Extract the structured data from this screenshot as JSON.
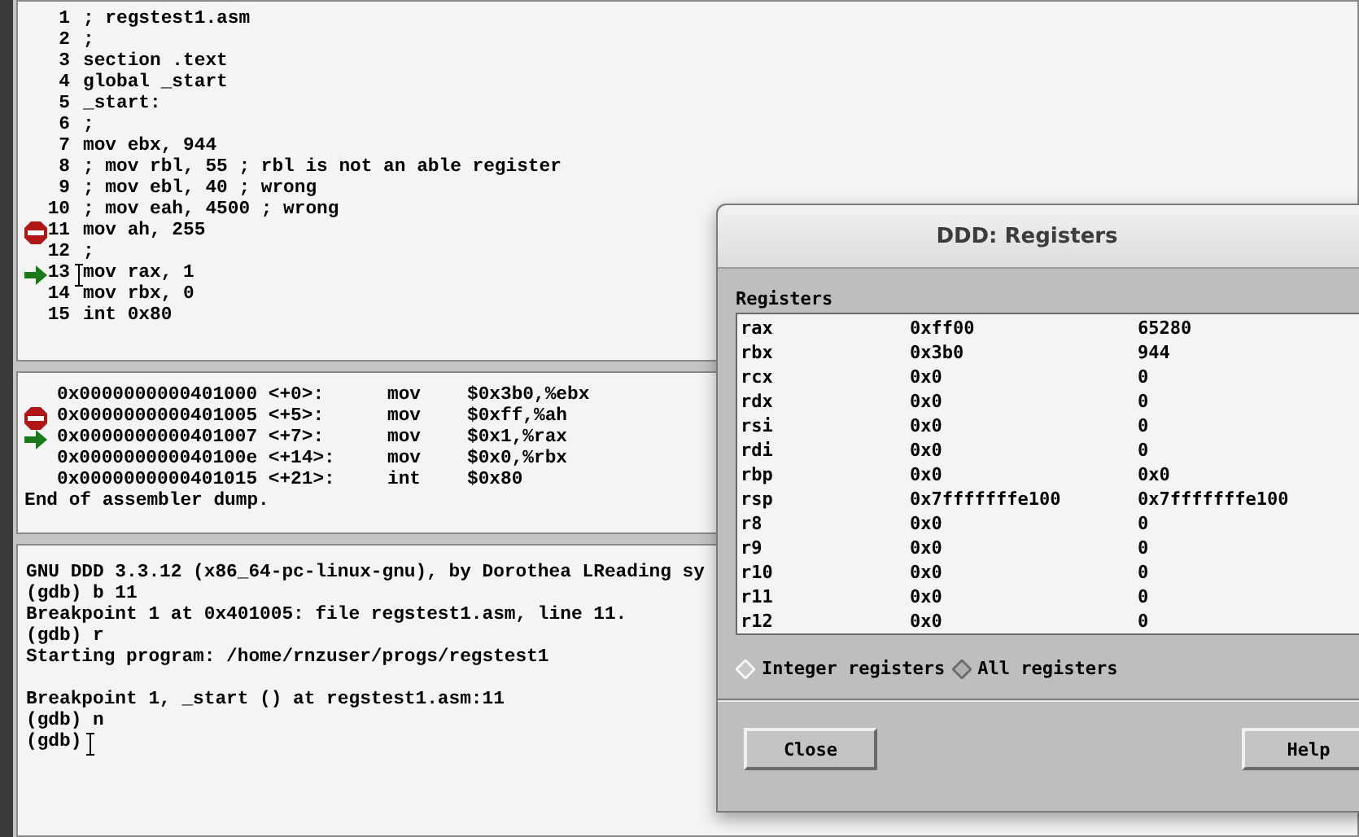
{
  "source": {
    "lines": [
      {
        "number": "1",
        "text": "; regstest1.asm",
        "breakpoint": false,
        "current": false
      },
      {
        "number": "2",
        "text": ";",
        "breakpoint": false,
        "current": false
      },
      {
        "number": "3",
        "text": "section .text",
        "breakpoint": false,
        "current": false
      },
      {
        "number": "4",
        "text": "global _start",
        "breakpoint": false,
        "current": false
      },
      {
        "number": "5",
        "text": "_start:",
        "breakpoint": false,
        "current": false
      },
      {
        "number": "6",
        "text": ";",
        "breakpoint": false,
        "current": false
      },
      {
        "number": "7",
        "text": "mov ebx, 944",
        "breakpoint": false,
        "current": false
      },
      {
        "number": "8",
        "text": "; mov rbl, 55 ; rbl is not an able register",
        "breakpoint": false,
        "current": false
      },
      {
        "number": "9",
        "text": "; mov ebl, 40 ; wrong",
        "breakpoint": false,
        "current": false
      },
      {
        "number": "10",
        "text": "; mov eah, 4500 ; wrong",
        "breakpoint": false,
        "current": false
      },
      {
        "number": "11",
        "text": "mov ah, 255",
        "breakpoint": true,
        "current": false
      },
      {
        "number": "12",
        "text": ";",
        "breakpoint": false,
        "current": false
      },
      {
        "number": "13",
        "text": "mov rax, 1",
        "breakpoint": false,
        "current": true
      },
      {
        "number": "14",
        "text": "mov rbx, 0",
        "breakpoint": false,
        "current": false
      },
      {
        "number": "15",
        "text": "int 0x80",
        "breakpoint": false,
        "current": false
      }
    ]
  },
  "disassembly": {
    "lines": [
      {
        "address": "0x0000000000401000 <+0>:",
        "mnemonic": "mov",
        "operand": "$0x3b0,%ebx",
        "breakpoint": false,
        "current": false
      },
      {
        "address": "0x0000000000401005 <+5>:",
        "mnemonic": "mov",
        "operand": "$0xff,%ah",
        "breakpoint": true,
        "current": false
      },
      {
        "address": "0x0000000000401007 <+7>:",
        "mnemonic": "mov",
        "operand": "$0x1,%rax",
        "breakpoint": false,
        "current": true
      },
      {
        "address": "0x000000000040100e <+14>:",
        "mnemonic": "mov",
        "operand": "$0x0,%rbx",
        "breakpoint": false,
        "current": false
      },
      {
        "address": "0x0000000000401015 <+21>:",
        "mnemonic": "int",
        "operand": "$0x80",
        "breakpoint": false,
        "current": false
      }
    ],
    "footer": "End of assembler dump."
  },
  "console": {
    "lines": [
      {
        "text": "GNU DDD 3.3.12 (x86_64-pc-linux-gnu), by Dorothea LReading sy",
        "spaced": false
      },
      {
        "text": "(gdb) b 11",
        "spaced": false
      },
      {
        "text": "Breakpoint 1 at 0x401005: file regstest1.asm, line 11.",
        "spaced": false
      },
      {
        "text": "(gdb) r",
        "spaced": false
      },
      {
        "text": "Starting program: /home/rnzuser/progs/regstest1",
        "spaced": false
      },
      {
        "text": "Breakpoint 1, _start () at regstest1.asm:11",
        "spaced": true
      },
      {
        "text": "(gdb) n",
        "spaced": false
      },
      {
        "text": "(gdb)",
        "spaced": false
      }
    ]
  },
  "registers_dialog": {
    "title": "DDD: Registers",
    "section_label": "Registers",
    "rows": [
      {
        "name": "rax",
        "hex": "0xff00",
        "value": "65280"
      },
      {
        "name": "rbx",
        "hex": "0x3b0",
        "value": "944"
      },
      {
        "name": "rcx",
        "hex": "0x0",
        "value": "0"
      },
      {
        "name": "rdx",
        "hex": "0x0",
        "value": "0"
      },
      {
        "name": "rsi",
        "hex": "0x0",
        "value": "0"
      },
      {
        "name": "rdi",
        "hex": "0x0",
        "value": "0"
      },
      {
        "name": "rbp",
        "hex": "0x0",
        "value": "0x0"
      },
      {
        "name": "rsp",
        "hex": "0x7fffffffe100",
        "value": "0x7fffffffe100"
      },
      {
        "name": "r8",
        "hex": "0x0",
        "value": "0"
      },
      {
        "name": "r9",
        "hex": "0x0",
        "value": "0"
      },
      {
        "name": "r10",
        "hex": "0x0",
        "value": "0"
      },
      {
        "name": "r11",
        "hex": "0x0",
        "value": "0"
      },
      {
        "name": "r12",
        "hex": "0x0",
        "value": "0"
      }
    ],
    "options": [
      {
        "label": "Integer registers",
        "selected": true
      },
      {
        "label": "All registers",
        "selected": false
      }
    ],
    "buttons": [
      {
        "label": "Close"
      },
      {
        "label": "Help"
      }
    ]
  }
}
